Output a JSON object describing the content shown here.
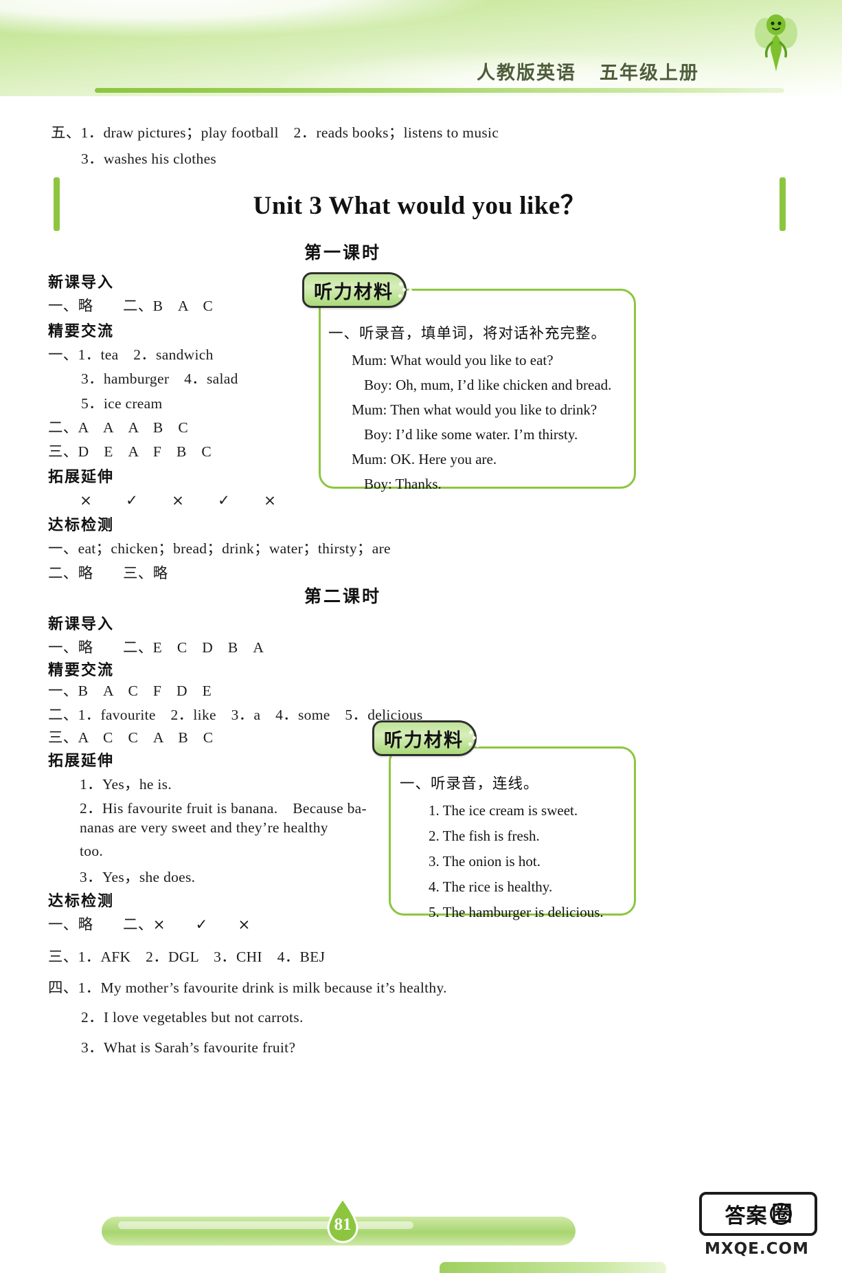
{
  "header": {
    "title_main": "人教版英语",
    "title_grade": "五年级上册",
    "mascot_icon": "fairy-mascot-icon"
  },
  "prev_unit_answers": {
    "line1": "五、1．draw pictures；play football　2．reads books；listens to music",
    "line2": "3．washes his clothes"
  },
  "unit": {
    "title": "Unit 3 What would you like？"
  },
  "lesson1": {
    "label": "第一课时",
    "sections": [
      {
        "heading": "新课导入",
        "lines": [
          "一、略　　二、B　A　C"
        ]
      },
      {
        "heading": "精要交流",
        "lines": [
          "一、1．tea　2．sandwich",
          "3．hamburger　4．salad",
          "5．ice cream",
          "二、A　A　A　B　C",
          "三、D　E　A　F　B　C"
        ]
      },
      {
        "heading": "拓展延伸",
        "lines": [
          "×　　✓　　×　　✓　　×"
        ]
      },
      {
        "heading": "达标检测",
        "lines": [
          "一、eat；chicken；bread；drink；water；thirsty；are",
          "二、略　　三、略"
        ]
      }
    ],
    "listening": {
      "tab_label": "听力材料",
      "question": "一、听录音，填单词，将对话补充完整。",
      "dialogue": [
        {
          "speaker": "Mum:",
          "text": "What would you like to eat?"
        },
        {
          "speaker": "Boy:",
          "text": "Oh, mum, I’d like chicken and bread."
        },
        {
          "speaker": "Mum:",
          "text": "Then what would you like to drink?"
        },
        {
          "speaker": "Boy:",
          "text": "I’d like some water. I’m thirsty."
        },
        {
          "speaker": "Mum:",
          "text": "OK. Here you are."
        },
        {
          "speaker": "Boy:",
          "text": "Thanks."
        }
      ]
    }
  },
  "lesson2": {
    "label": "第二课时",
    "sections": [
      {
        "heading": "新课导入",
        "lines": [
          "一、略　　二、E　C　D　B　A"
        ]
      },
      {
        "heading": "精要交流",
        "lines": [
          "一、B　A　C　F　D　E",
          "二、1．favourite　2．like　3．a　4．some　5．delicious",
          "三、A　C　C　A　B　C"
        ]
      },
      {
        "heading": "拓展延伸",
        "lines": [
          "1．Yes，he is.",
          "2．His favourite fruit is banana.　Because ba-",
          "nanas are very sweet and they’re healthy",
          "too.",
          "3．Yes，she does."
        ]
      },
      {
        "heading": "达标检测",
        "lines": [
          "一、略　　二、×　　✓　　×",
          "三、1．AFK　2．DGL　3．CHI　4．BEJ",
          "四、1．My mother’s favourite drink is milk because it’s healthy.",
          "2．I love vegetables but not carrots.",
          "3．What is Sarah’s favourite fruit?"
        ]
      }
    ],
    "listening": {
      "tab_label": "听力材料",
      "question": "一、听录音，连线。",
      "items": [
        "1. The ice cream is sweet.",
        "2. The fish is fresh.",
        "3. The onion is hot.",
        "4. The rice is healthy.",
        "5. The hamburger is delicious."
      ]
    }
  },
  "footer": {
    "page_number": "81"
  },
  "watermark": {
    "badge_text": "答案",
    "badge_circle": "圈",
    "url_text": "MXQE.COM"
  },
  "colors": {
    "accent_green": "#8cc63f",
    "light_green": "#cdeaa4",
    "ink": "#1c1c1c"
  }
}
